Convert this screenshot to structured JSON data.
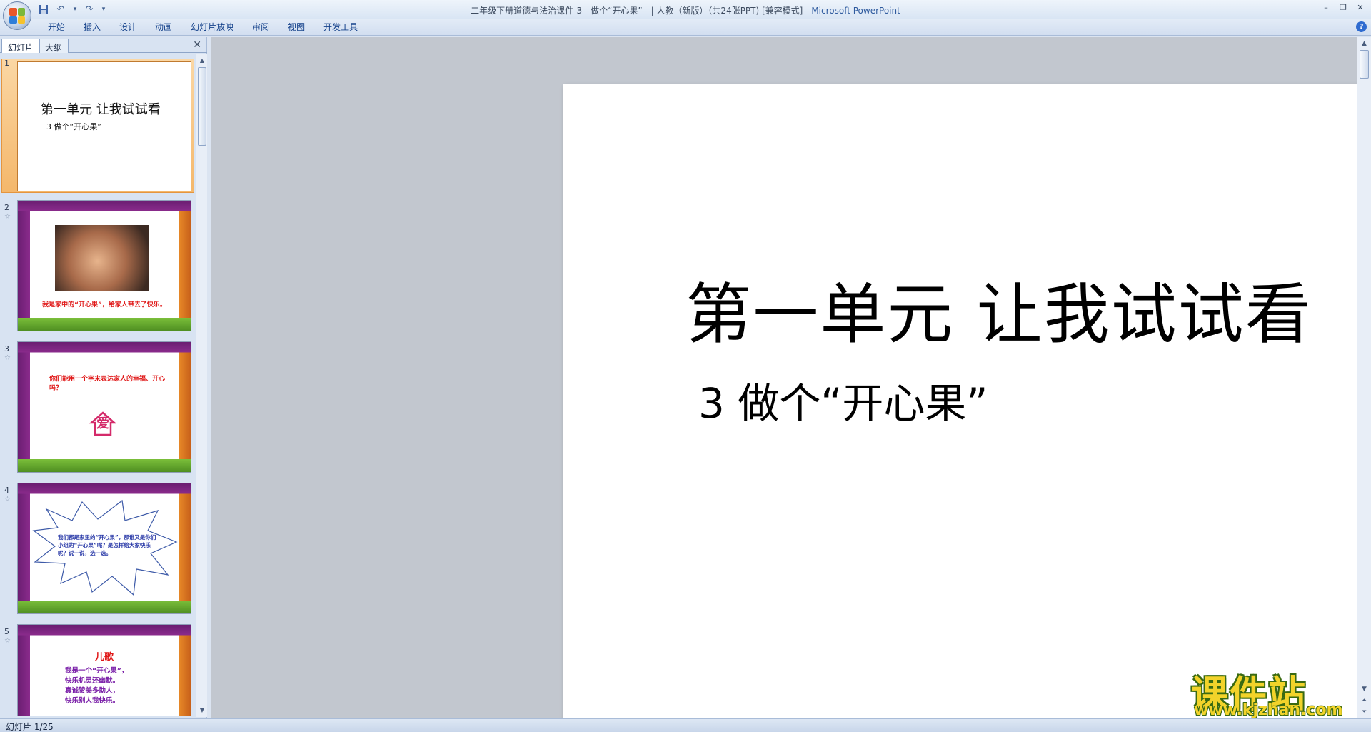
{
  "window": {
    "title_doc": "二年级下册道德与法治课件-3　做个“开心果”　| 人教（新版）（共24张PPT) [兼容模式] - ",
    "title_app": "Microsoft PowerPoint",
    "minimize": "–",
    "restore": "❐",
    "close": "✕"
  },
  "quick_access": {
    "save_icon": "save-icon",
    "undo_icon": "undo-icon",
    "redo_icon": "redo-icon",
    "dropdown": "▾"
  },
  "ribbon": {
    "tabs": [
      {
        "label": "开始"
      },
      {
        "label": "插入"
      },
      {
        "label": "设计"
      },
      {
        "label": "动画"
      },
      {
        "label": "幻灯片放映"
      },
      {
        "label": "审阅"
      },
      {
        "label": "视图"
      },
      {
        "label": "开发工具"
      }
    ],
    "help": "?"
  },
  "left_panel": {
    "tab_slides": "幻灯片",
    "tab_outline": "大纲",
    "close": "✕",
    "thumbnails": [
      {
        "num": "1",
        "title": "第一单元  让我试试看",
        "subtitle": "3  做个“开心果”"
      },
      {
        "num": "2",
        "star": "☆",
        "caption": "我是家中的“开心果”，给家人带去了快乐。"
      },
      {
        "num": "3",
        "star": "☆",
        "text": "你们能用一个字来表达家人的幸福、开心吗？",
        "love": "爱"
      },
      {
        "num": "4",
        "star": "☆",
        "text": "我们都是家里的“开心果”，那谁又是你们小组的“开心果”呢？是怎样给大家快乐呢？说一说，选一选。"
      },
      {
        "num": "5",
        "star": "☆",
        "title": "儿歌",
        "lines": [
          "我是一个“开心果”，",
          "快乐机灵还幽默。",
          "真诚赞美多助人，",
          "快乐别人我快乐。"
        ]
      }
    ]
  },
  "slide": {
    "title": "第一单元  让我试试看",
    "subtitle": "3  做个“开心果”"
  },
  "status": {
    "slide_counter": "幻灯片 1/25"
  },
  "watermark": {
    "main": "课件站",
    "url": "www.kjzhan.com"
  }
}
